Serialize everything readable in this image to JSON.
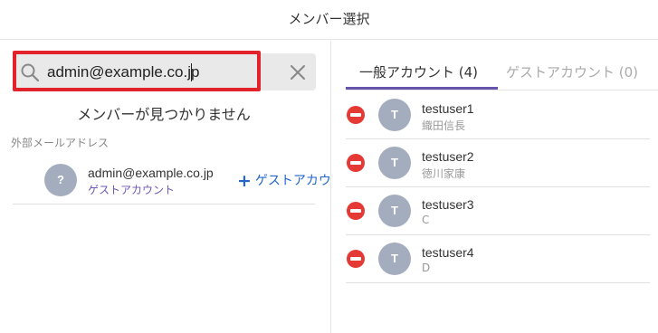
{
  "header": {
    "title": "メンバー選択"
  },
  "search": {
    "value": "admin@example.co.jp",
    "clear_icon": "close-icon",
    "search_icon": "search-icon"
  },
  "results": {
    "not_found_message": "メンバーが見つかりません"
  },
  "external": {
    "section_label": "外部メールアドレス",
    "item": {
      "avatar_text": "?",
      "email": "admin@example.co.jp",
      "type": "ゲストアカウント"
    },
    "add_guest_label": "ゲストアカウ"
  },
  "tabs": [
    {
      "label": "一般アカウント (4)",
      "active": true
    },
    {
      "label": "ゲストアカウント (0)",
      "active": false
    }
  ],
  "members": [
    {
      "avatar_text": "T",
      "name": "testuser1",
      "sub": "織田信長"
    },
    {
      "avatar_text": "T",
      "name": "testuser2",
      "sub": "徳川家康"
    },
    {
      "avatar_text": "T",
      "name": "testuser3",
      "sub": "C"
    },
    {
      "avatar_text": "T",
      "name": "testuser4",
      "sub": "D"
    }
  ],
  "colors": {
    "accent": "#6655aa",
    "remove": "#e53935",
    "avatar": "#a4adbd",
    "highlight": "#e2232c",
    "link": "#2266cc"
  }
}
